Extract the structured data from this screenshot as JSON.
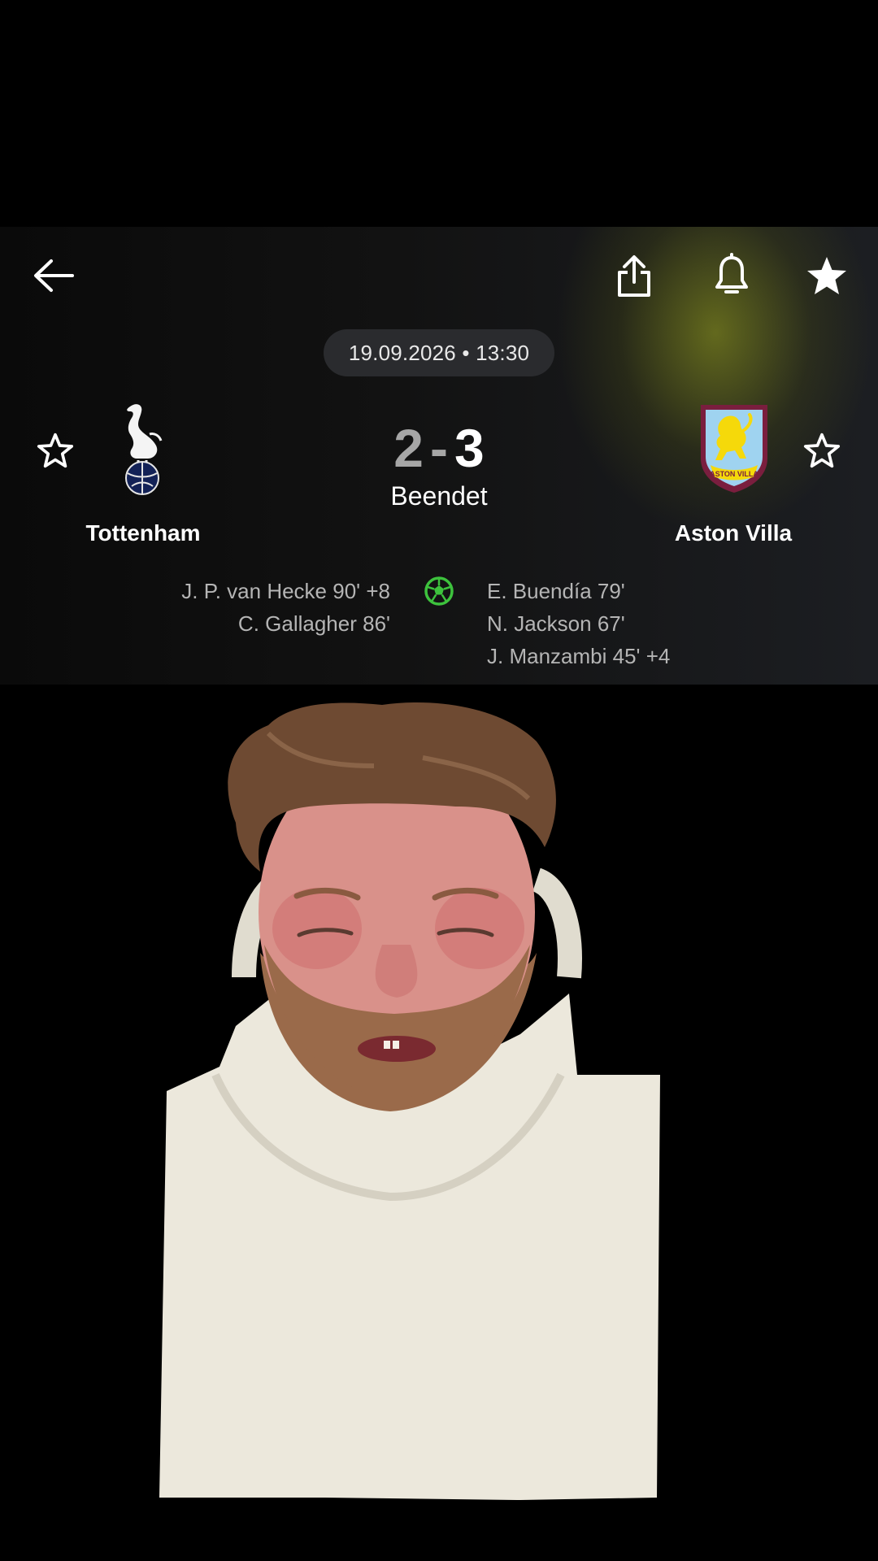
{
  "header": {
    "back_icon": "arrow-left-icon",
    "share_icon": "share-icon",
    "bell_icon": "bell-icon",
    "favorite_icon": "star-filled-icon"
  },
  "match": {
    "datetime": "19.09.2026 • 13:30",
    "home_team": "Tottenham",
    "away_team": "Aston Villa",
    "home_score": "2",
    "score_separator": "-",
    "away_score": "3",
    "status": "Beendet",
    "home_scorers": [
      "J. P. van Hecke 90' +8",
      "C. Gallagher 86'"
    ],
    "away_scorers": [
      "E. Buendía 79'",
      "N. Jackson 67'",
      "J. Manzambi 45' +4"
    ],
    "crests": {
      "home": "tottenham-crest",
      "away": "aston-villa-crest",
      "away_crest_text": "ASTON VILLA"
    }
  },
  "colors": {
    "accent_green": "#3dc23d",
    "villa_claret": "#7a1e3e",
    "villa_blue": "#9fd3f0",
    "villa_yellow": "#f5d90a",
    "spurs_navy": "#132257"
  }
}
